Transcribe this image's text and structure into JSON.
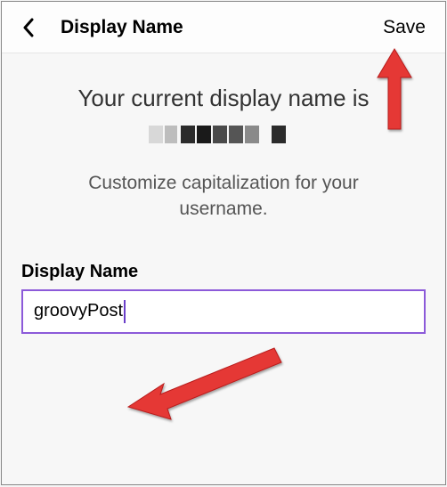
{
  "header": {
    "title": "Display Name",
    "save_label": "Save"
  },
  "main": {
    "heading_line1": "Your current display name is",
    "subtext_line1": "Customize capitalization for your",
    "subtext_line2": "username."
  },
  "field": {
    "label": "Display Name",
    "value": "groovyPost"
  }
}
